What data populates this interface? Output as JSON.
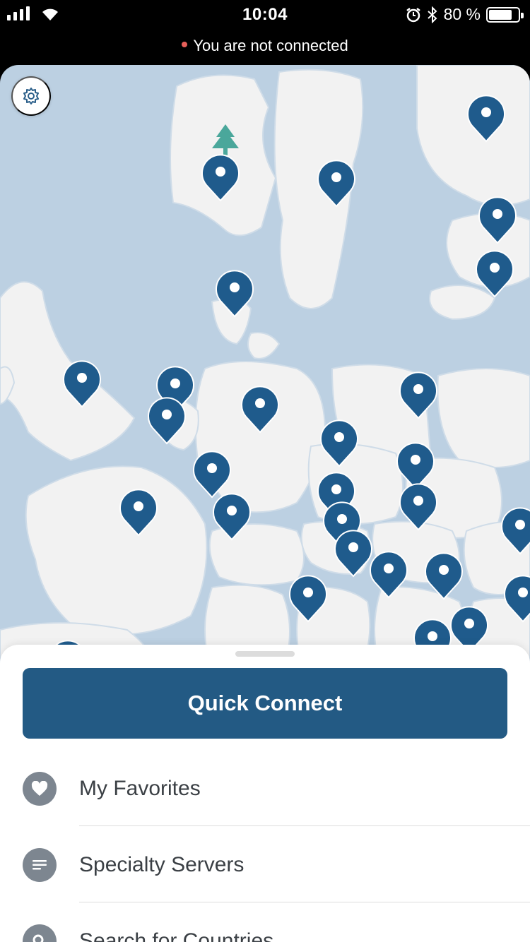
{
  "status_bar": {
    "time": "10:04",
    "battery": "80 %",
    "battery_level": 0.8
  },
  "connection": {
    "status_text": "You are not connected",
    "status_color": "#e8605a"
  },
  "map": {
    "icons": {
      "settings": "gear-icon",
      "server_marker": "location-pin-icon",
      "tree": "tree-icon"
    },
    "colors": {
      "water": "#bcd0e2",
      "land": "#f2f2f2",
      "pin": "#1f5b8c",
      "tree": "#4aa79b"
    }
  },
  "sheet": {
    "quick_connect_label": "Quick Connect",
    "accent_color": "#235a84",
    "items": [
      {
        "label": "My Favorites",
        "icon": "heart-icon"
      },
      {
        "label": "Specialty Servers",
        "icon": "list-icon"
      },
      {
        "label": "Search for Countries",
        "icon": "search-icon"
      }
    ]
  }
}
